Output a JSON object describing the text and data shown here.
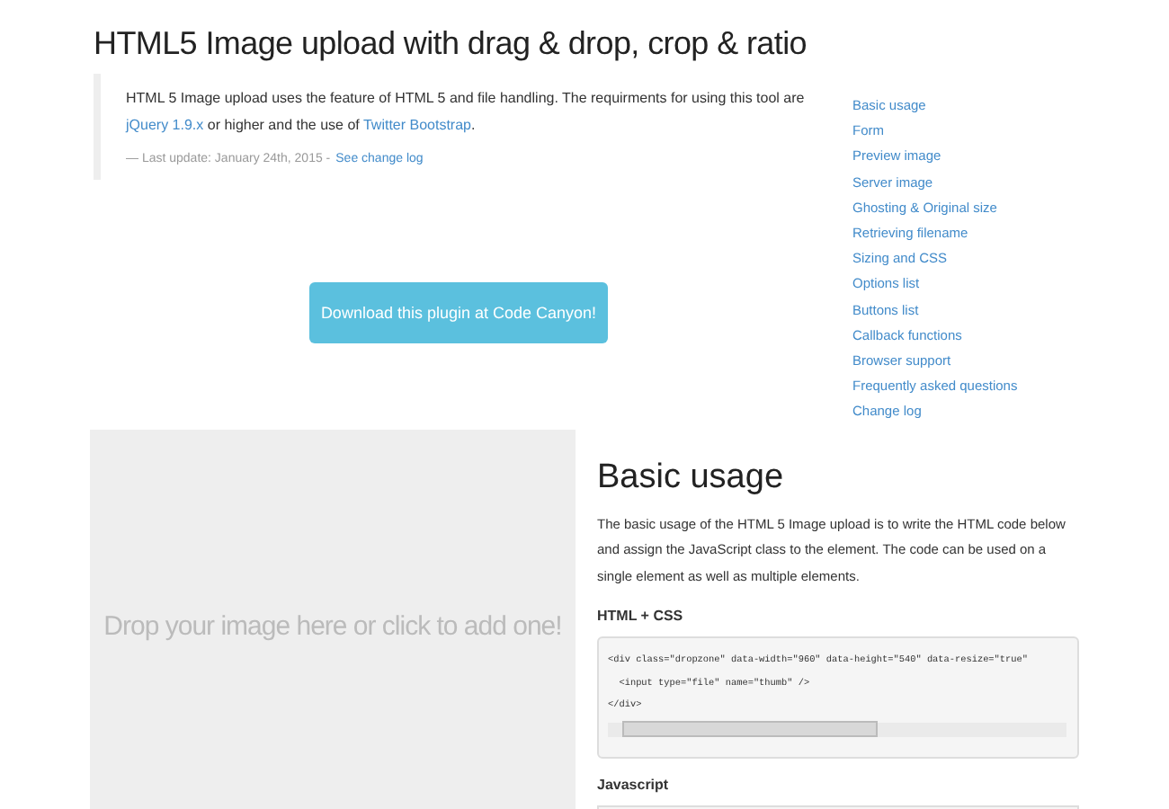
{
  "title": "HTML5 Image upload with drag & drop, crop & ratio",
  "intro": {
    "links": [
      "jQuery 1.9.x",
      "Twitter Bootstrap"
    ],
    "before": [
      "HTML 5 Image upload uses the feature of HTML 5 and file handling. The requirments for using this tool are ",
      "or higher and the use of ",
      "."
    ],
    "footer": "— Last update: January 24th, 2015 -",
    "footer_link": "See change log"
  },
  "nav": [
    "Basic usage",
    "Form",
    "Preview image",
    "Server image",
    "Ghosting & Original size",
    "Retrieving filename",
    "Sizing and CSS",
    "Options list",
    "Buttons list",
    "Callback functions",
    "Browser support",
    "Frequently asked questions",
    "Change log"
  ],
  "download_button": "Download this plugin at Code Canyon!",
  "dropzone": {
    "placeholder": "Drop your image here or click to add one!"
  },
  "section": {
    "heading": "Basic usage",
    "paragraph": "The basic usage of the HTML 5 Image upload is to write the HTML code below and assign the JavaScript class to the element. The code can be used on a single element as well as multiple elements.",
    "subheadings": [
      "HTML + CSS",
      "Javascript"
    ],
    "code_lines": [
      "<div class=\"dropzone\" data-width=\"960\" data-height=\"540\" data-resize=\"true\"",
      "  <input type=\"file\" name=\"thumb\" />",
      "</div>"
    ]
  }
}
